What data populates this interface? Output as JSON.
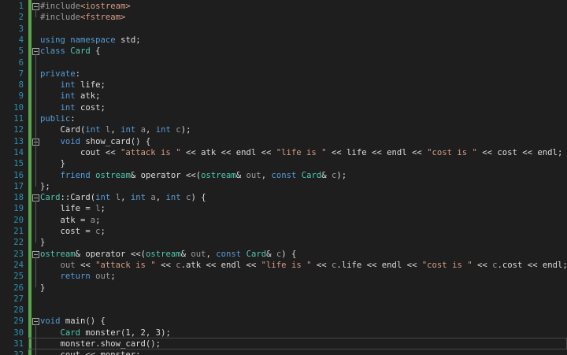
{
  "editor": {
    "language": "C++",
    "current_line": 31,
    "lines": [
      {
        "n": "1",
        "indent": 0,
        "fold": true,
        "tokens": [
          {
            "c": "t-pre",
            "t": "#include"
          },
          {
            "c": "t-str",
            "t": "<iostream>"
          }
        ]
      },
      {
        "n": "2",
        "indent": 0,
        "fold": false,
        "tokens": [
          {
            "c": "t-pre",
            "t": "#include"
          },
          {
            "c": "t-str",
            "t": "<fstream>"
          }
        ]
      },
      {
        "n": "3",
        "indent": 0,
        "fold": false,
        "tokens": []
      },
      {
        "n": "4",
        "indent": 0,
        "fold": false,
        "tokens": [
          {
            "c": "t-kw",
            "t": "using"
          },
          {
            "c": "t-plain",
            "t": " "
          },
          {
            "c": "t-kw",
            "t": "namespace"
          },
          {
            "c": "t-plain",
            "t": " std;"
          }
        ]
      },
      {
        "n": "5",
        "indent": 0,
        "fold": true,
        "tokens": [
          {
            "c": "t-kw",
            "t": "class"
          },
          {
            "c": "t-plain",
            "t": " "
          },
          {
            "c": "t-type",
            "t": "Card"
          },
          {
            "c": "t-plain",
            "t": " {"
          }
        ]
      },
      {
        "n": "6",
        "indent": 0,
        "fold": false,
        "tokens": []
      },
      {
        "n": "7",
        "indent": 0,
        "fold": false,
        "tokens": [
          {
            "c": "t-kw",
            "t": "private"
          },
          {
            "c": "t-plain",
            "t": ":"
          }
        ]
      },
      {
        "n": "8",
        "indent": 1,
        "fold": false,
        "tokens": [
          {
            "c": "t-kw",
            "t": "int"
          },
          {
            "c": "t-plain",
            "t": " life;"
          }
        ]
      },
      {
        "n": "9",
        "indent": 1,
        "fold": false,
        "tokens": [
          {
            "c": "t-kw",
            "t": "int"
          },
          {
            "c": "t-plain",
            "t": " atk;"
          }
        ]
      },
      {
        "n": "10",
        "indent": 1,
        "fold": false,
        "tokens": [
          {
            "c": "t-kw",
            "t": "int"
          },
          {
            "c": "t-plain",
            "t": " cost;"
          }
        ]
      },
      {
        "n": "11",
        "indent": 0,
        "fold": false,
        "tokens": [
          {
            "c": "t-kw",
            "t": "public"
          },
          {
            "c": "t-plain",
            "t": ":"
          }
        ]
      },
      {
        "n": "12",
        "indent": 1,
        "fold": false,
        "tokens": [
          {
            "c": "t-plain",
            "t": "Card("
          },
          {
            "c": "t-kw",
            "t": "int"
          },
          {
            "c": "t-plain",
            "t": " "
          },
          {
            "c": "t-param",
            "t": "l"
          },
          {
            "c": "t-plain",
            "t": ", "
          },
          {
            "c": "t-kw",
            "t": "int"
          },
          {
            "c": "t-plain",
            "t": " "
          },
          {
            "c": "t-param",
            "t": "a"
          },
          {
            "c": "t-plain",
            "t": ", "
          },
          {
            "c": "t-kw",
            "t": "int"
          },
          {
            "c": "t-plain",
            "t": " "
          },
          {
            "c": "t-param",
            "t": "c"
          },
          {
            "c": "t-plain",
            "t": ");"
          }
        ]
      },
      {
        "n": "13",
        "indent": 1,
        "fold": true,
        "tokens": [
          {
            "c": "t-kw",
            "t": "void"
          },
          {
            "c": "t-plain",
            "t": " show_card() {"
          }
        ]
      },
      {
        "n": "14",
        "indent": 2,
        "fold": false,
        "tokens": [
          {
            "c": "t-plain",
            "t": "cout << "
          },
          {
            "c": "t-str",
            "t": "\"attack is \""
          },
          {
            "c": "t-plain",
            "t": " << atk << endl << "
          },
          {
            "c": "t-str",
            "t": "\"life is \""
          },
          {
            "c": "t-plain",
            "t": " << life << endl << "
          },
          {
            "c": "t-str",
            "t": "\"cost is \""
          },
          {
            "c": "t-plain",
            "t": " << cost << endl;"
          }
        ]
      },
      {
        "n": "15",
        "indent": 1,
        "fold": false,
        "tokens": [
          {
            "c": "t-plain",
            "t": "}"
          }
        ]
      },
      {
        "n": "16",
        "indent": 1,
        "fold": false,
        "tokens": [
          {
            "c": "t-kw",
            "t": "friend"
          },
          {
            "c": "t-plain",
            "t": " "
          },
          {
            "c": "t-type",
            "t": "ostream"
          },
          {
            "c": "t-plain",
            "t": "& operator <<("
          },
          {
            "c": "t-type",
            "t": "ostream"
          },
          {
            "c": "t-plain",
            "t": "& "
          },
          {
            "c": "t-param",
            "t": "out"
          },
          {
            "c": "t-plain",
            "t": ", "
          },
          {
            "c": "t-kw",
            "t": "const"
          },
          {
            "c": "t-plain",
            "t": " "
          },
          {
            "c": "t-type",
            "t": "Card"
          },
          {
            "c": "t-plain",
            "t": "& "
          },
          {
            "c": "t-param",
            "t": "c"
          },
          {
            "c": "t-plain",
            "t": ");"
          }
        ]
      },
      {
        "n": "17",
        "indent": 0,
        "fold": false,
        "tokens": [
          {
            "c": "t-plain",
            "t": "};"
          }
        ]
      },
      {
        "n": "18",
        "indent": 0,
        "fold": true,
        "tokens": [
          {
            "c": "t-type",
            "t": "Card"
          },
          {
            "c": "t-plain",
            "t": "::Card("
          },
          {
            "c": "t-kw",
            "t": "int"
          },
          {
            "c": "t-plain",
            "t": " "
          },
          {
            "c": "t-param",
            "t": "l"
          },
          {
            "c": "t-plain",
            "t": ", "
          },
          {
            "c": "t-kw",
            "t": "int"
          },
          {
            "c": "t-plain",
            "t": " "
          },
          {
            "c": "t-param",
            "t": "a"
          },
          {
            "c": "t-plain",
            "t": ", "
          },
          {
            "c": "t-kw",
            "t": "int"
          },
          {
            "c": "t-plain",
            "t": " "
          },
          {
            "c": "t-param",
            "t": "c"
          },
          {
            "c": "t-plain",
            "t": ") {"
          }
        ]
      },
      {
        "n": "19",
        "indent": 1,
        "fold": false,
        "tokens": [
          {
            "c": "t-plain",
            "t": "life = "
          },
          {
            "c": "t-param",
            "t": "l"
          },
          {
            "c": "t-plain",
            "t": ";"
          }
        ]
      },
      {
        "n": "20",
        "indent": 1,
        "fold": false,
        "tokens": [
          {
            "c": "t-plain",
            "t": "atk = "
          },
          {
            "c": "t-param",
            "t": "a"
          },
          {
            "c": "t-plain",
            "t": ";"
          }
        ]
      },
      {
        "n": "21",
        "indent": 1,
        "fold": false,
        "tokens": [
          {
            "c": "t-plain",
            "t": "cost = "
          },
          {
            "c": "t-param",
            "t": "c"
          },
          {
            "c": "t-plain",
            "t": ";"
          }
        ]
      },
      {
        "n": "22",
        "indent": 0,
        "fold": false,
        "tokens": [
          {
            "c": "t-plain",
            "t": "}"
          }
        ]
      },
      {
        "n": "23",
        "indent": 0,
        "fold": true,
        "tokens": [
          {
            "c": "t-type",
            "t": "ostream"
          },
          {
            "c": "t-plain",
            "t": "& operator <<("
          },
          {
            "c": "t-type",
            "t": "ostream"
          },
          {
            "c": "t-plain",
            "t": "& "
          },
          {
            "c": "t-param",
            "t": "out"
          },
          {
            "c": "t-plain",
            "t": ", "
          },
          {
            "c": "t-kw",
            "t": "const"
          },
          {
            "c": "t-plain",
            "t": " "
          },
          {
            "c": "t-type",
            "t": "Card"
          },
          {
            "c": "t-plain",
            "t": "& "
          },
          {
            "c": "t-param",
            "t": "c"
          },
          {
            "c": "t-plain",
            "t": ") {"
          }
        ]
      },
      {
        "n": "24",
        "indent": 1,
        "fold": false,
        "tokens": [
          {
            "c": "t-param",
            "t": "out"
          },
          {
            "c": "t-plain",
            "t": " << "
          },
          {
            "c": "t-str",
            "t": "\"attack is \""
          },
          {
            "c": "t-plain",
            "t": " << "
          },
          {
            "c": "t-param",
            "t": "c"
          },
          {
            "c": "t-plain",
            "t": ".atk << endl << "
          },
          {
            "c": "t-str",
            "t": "\"life is \""
          },
          {
            "c": "t-plain",
            "t": " << "
          },
          {
            "c": "t-param",
            "t": "c"
          },
          {
            "c": "t-plain",
            "t": ".life << endl << "
          },
          {
            "c": "t-str",
            "t": "\"cost is \""
          },
          {
            "c": "t-plain",
            "t": " << "
          },
          {
            "c": "t-param",
            "t": "c"
          },
          {
            "c": "t-plain",
            "t": ".cost << endl;"
          }
        ]
      },
      {
        "n": "25",
        "indent": 1,
        "fold": false,
        "tokens": [
          {
            "c": "t-kw",
            "t": "return"
          },
          {
            "c": "t-plain",
            "t": " "
          },
          {
            "c": "t-param",
            "t": "out"
          },
          {
            "c": "t-plain",
            "t": ";"
          }
        ]
      },
      {
        "n": "26",
        "indent": 0,
        "fold": false,
        "tokens": [
          {
            "c": "t-plain",
            "t": "}"
          }
        ]
      },
      {
        "n": "27",
        "indent": 0,
        "fold": false,
        "tokens": []
      },
      {
        "n": "28",
        "indent": 0,
        "fold": false,
        "tokens": []
      },
      {
        "n": "29",
        "indent": 0,
        "fold": true,
        "tokens": [
          {
            "c": "t-kw",
            "t": "void"
          },
          {
            "c": "t-plain",
            "t": " main() {"
          }
        ]
      },
      {
        "n": "30",
        "indent": 1,
        "fold": false,
        "tokens": [
          {
            "c": "t-type",
            "t": "Card"
          },
          {
            "c": "t-plain",
            "t": " monster(1, 2, 3);"
          }
        ]
      },
      {
        "n": "31",
        "indent": 1,
        "fold": false,
        "tokens": [
          {
            "c": "t-plain",
            "t": "monster.show_card();"
          }
        ]
      },
      {
        "n": "32",
        "indent": 1,
        "fold": false,
        "tokens": [
          {
            "c": "t-plain",
            "t": "cout << monster;"
          }
        ]
      }
    ]
  }
}
